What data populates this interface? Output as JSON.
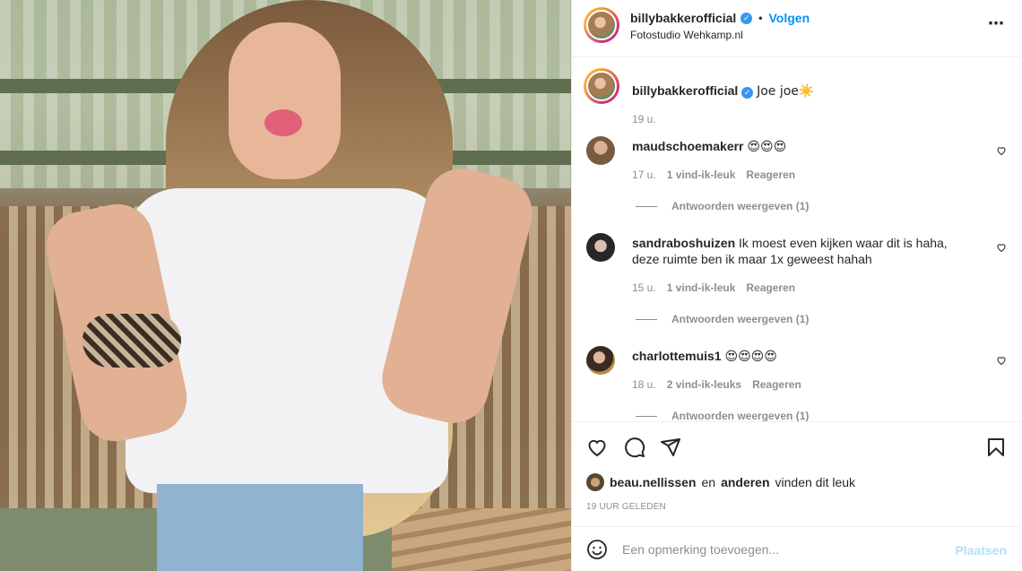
{
  "post": {
    "username": "billybakkerofficial",
    "verified_mark": "✓",
    "separator": "•",
    "follow_label": "Volgen",
    "location": "Fotostudio Wehkamp.nl",
    "more_icon": "⋯",
    "caption_text": "Joe joe☀️",
    "caption_time": "19 u."
  },
  "comments": [
    {
      "user": "maudschoemakerr",
      "text": "😍😍😍",
      "time": "17 u.",
      "likes": "1 vind-ik-leuk",
      "reply": "Reageren",
      "view_replies": "Antwoorden weergeven (1)"
    },
    {
      "user": "sandraboshuizen",
      "text": "Ik moest even kijken waar dit is haha, deze ruimte ben ik maar 1x geweest hahah",
      "time": "15 u.",
      "likes": "1 vind-ik-leuk",
      "reply": "Reageren",
      "view_replies": "Antwoorden weergeven (1)"
    },
    {
      "user": "charlottemuis1",
      "text": "😍😍😍😍",
      "time": "18 u.",
      "likes": "2 vind-ik-leuks",
      "reply": "Reageren",
      "view_replies": "Antwoorden weergeven (1)"
    }
  ],
  "likes": {
    "first_user": "beau.nellissen",
    "joiner": "en",
    "others": "anderen",
    "suffix": "vinden dit leuk"
  },
  "timestamp": "19 UUR GELEDEN",
  "add_comment": {
    "placeholder": "Een opmerking toevoegen...",
    "post_label": "Plaatsen"
  },
  "colors": {
    "accent": "#0095f6",
    "muted": "#8e8e8e",
    "post_disabled": "#b2dffc"
  }
}
